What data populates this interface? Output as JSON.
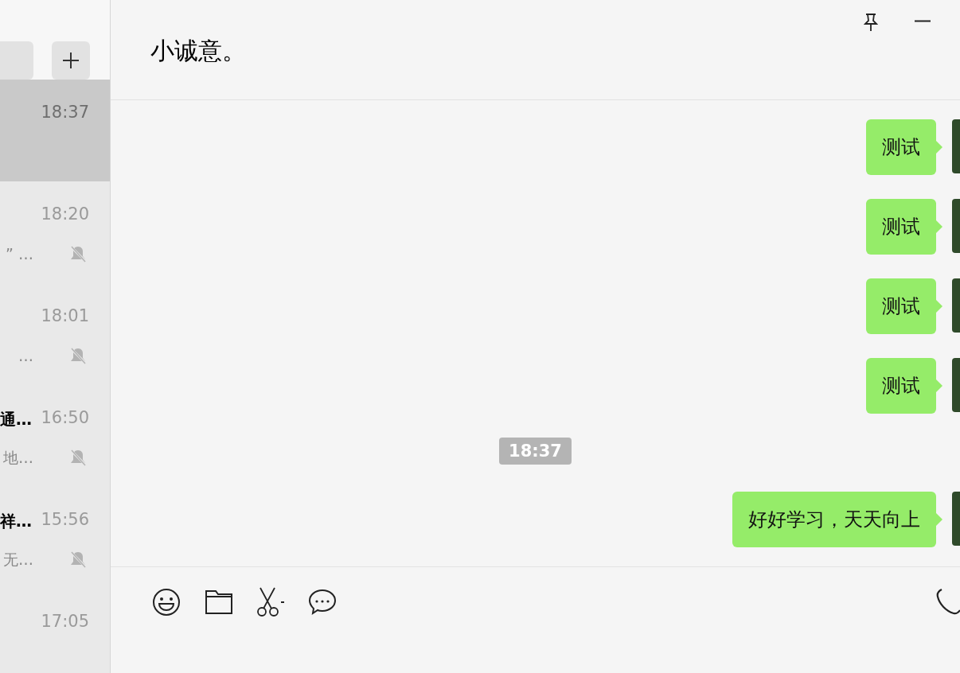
{
  "chat_list": [
    {
      "time": "18:37",
      "selected": true,
      "muted": false
    },
    {
      "time": "18:20",
      "preview": "” …",
      "selected": false,
      "muted": true
    },
    {
      "time": "18:01",
      "preview": "…",
      "selected": false,
      "muted": true
    },
    {
      "title": "通…",
      "time": "16:50",
      "preview": "地…",
      "selected": false,
      "muted": true
    },
    {
      "title": "祥…",
      "time": "15:56",
      "preview": "无…",
      "selected": false,
      "muted": true
    },
    {
      "time": "17:05",
      "selected": false,
      "muted": false
    }
  ],
  "chat": {
    "title": "小诚意。",
    "messages": [
      {
        "kind": "sent",
        "text": "测试"
      },
      {
        "kind": "sent",
        "text": "测试"
      },
      {
        "kind": "sent",
        "text": "测试"
      },
      {
        "kind": "sent",
        "text": "测试"
      },
      {
        "kind": "time",
        "text": "18:37"
      },
      {
        "kind": "sent",
        "text": "好好学习，天天向上"
      }
    ]
  }
}
